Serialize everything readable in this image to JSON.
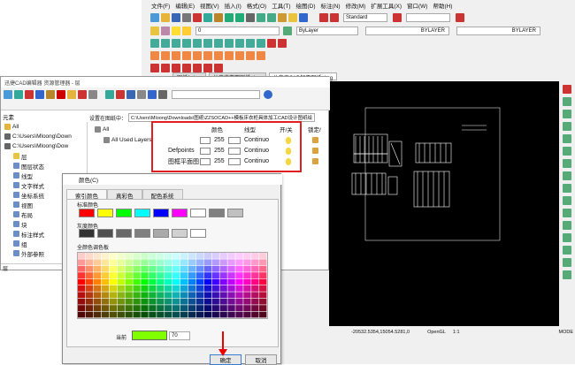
{
  "menu": [
    "文件(F)",
    "编辑(E)",
    "视图(V)",
    "插入(I)",
    "格式(O)",
    "工具(T)",
    "绘图(D)",
    "标注(N)",
    "修改(M)",
    "扩展工具(X)",
    "窗口(W)",
    "帮助(H)"
  ],
  "toolbar": {
    "text_style": "Standard",
    "layer_value": "0",
    "linetype": "BYLAYER",
    "linetype2": "BYLAYER",
    "color": "ByLayer"
  },
  "tabs": [
    "图纸1.dwg",
    "儿童床立面图纸.dwg",
    "儿童床CAD加工图纸.dwg"
  ],
  "status": {
    "coords": "-20532.5354,15054.5281,0",
    "opengl": "OpenGL",
    "ratio": "1:1",
    "mode": "MODE"
  },
  "resource_manager": {
    "title": "迅捷CAD编辑器 资源管理器 - 层",
    "left_header": "元素",
    "tree": [
      {
        "label": "All",
        "depth": 0,
        "icon": "folder-icon"
      },
      {
        "label": "C:\\Users\\Mloong\\Down",
        "depth": 0,
        "icon": "drawing-icon"
      },
      {
        "label": "C:\\Users\\Mloong\\Dow",
        "depth": 0,
        "icon": "drawing-icon"
      },
      {
        "label": "层",
        "depth": 1,
        "icon": "layer-icon"
      },
      {
        "label": "图层状态",
        "depth": 1,
        "icon": "layer-state-icon"
      },
      {
        "label": "线型",
        "depth": 1,
        "icon": "linetype-icon"
      },
      {
        "label": "文字样式",
        "depth": 1,
        "icon": "text-style-icon"
      },
      {
        "label": "坐标系统",
        "depth": 1,
        "icon": "ucs-icon"
      },
      {
        "label": "视图",
        "depth": 1,
        "icon": "view-icon"
      },
      {
        "label": "布局",
        "depth": 1,
        "icon": "layout-icon"
      },
      {
        "label": "块",
        "depth": 1,
        "icon": "block-icon"
      },
      {
        "label": "标注样式",
        "depth": 1,
        "icon": "dimstyle-icon"
      },
      {
        "label": "组",
        "depth": 1,
        "icon": "group-icon"
      },
      {
        "label": "外部参照",
        "depth": 1,
        "icon": "xref-icon"
      }
    ],
    "bottom_tab": "层",
    "subtree": [
      {
        "label": "All"
      },
      {
        "label": "All Used Layers"
      }
    ],
    "path_label": "设置在图纸中：",
    "path_value": "C:\\Users\\Mloong\\Downloads\\图纸\\ZZSOCAD++模板床衣柜具体加工CAD设计图纸绘",
    "columns": [
      "颜色",
      "线型",
      "开/关",
      "锁定/"
    ],
    "rows": [
      {
        "name": "",
        "color": "255",
        "linetype": "Continuo"
      },
      {
        "name": "Defpoints",
        "color": "255",
        "linetype": "Continuo"
      },
      {
        "name": "图框平面图",
        "color": "255",
        "linetype": "Continuo"
      }
    ]
  },
  "color_dialog": {
    "title": "颜色(C)",
    "tabs": [
      "索引颜色",
      "真彩色",
      "配色系统"
    ],
    "standard_label": "标准颜色",
    "standard_colors": [
      "#ff0000",
      "#ffff00",
      "#00ff00",
      "#00ffff",
      "#0000ff",
      "#ff00ff",
      "#ffffff",
      "#808080",
      "#c0c0c0"
    ],
    "gray_label": "灰度颜色",
    "gray_colors": [
      "#333333",
      "#505050",
      "#696969",
      "#808080",
      "#aaaaaa",
      "#d0d0d0",
      "#ffffff"
    ],
    "palette_label": "全颜色调色板",
    "current_label": "当前",
    "current_color": "#7fff00",
    "current_value": "70",
    "ok": "确定",
    "cancel": "取消"
  }
}
